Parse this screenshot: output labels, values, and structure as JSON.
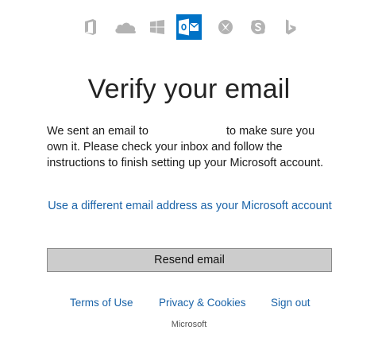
{
  "product_icons": [
    {
      "icon": "office-icon",
      "active": false
    },
    {
      "icon": "onedrive-icon",
      "active": false
    },
    {
      "icon": "windows-icon",
      "active": false
    },
    {
      "icon": "outlook-icon",
      "active": true
    },
    {
      "icon": "xbox-icon",
      "active": false
    },
    {
      "icon": "skype-icon",
      "active": false
    },
    {
      "icon": "bing-icon",
      "active": false
    }
  ],
  "colors": {
    "accent": "#0072c6",
    "link": "#1a63a8",
    "icon_inactive": "#b3b3b3",
    "button_bg": "#cccccc"
  },
  "heading": "Verify your email",
  "message": {
    "before_email": "We sent an email to",
    "after_email": "to make sure you own it. Please check your inbox and follow the instructions to finish setting up your Microsoft account."
  },
  "alt_email_link": "Use a different email address as your Microsoft account",
  "resend_button": "Resend email",
  "footer": {
    "terms": "Terms of Use",
    "privacy": "Privacy & Cookies",
    "sign_out": "Sign out",
    "brand": "Microsoft"
  }
}
